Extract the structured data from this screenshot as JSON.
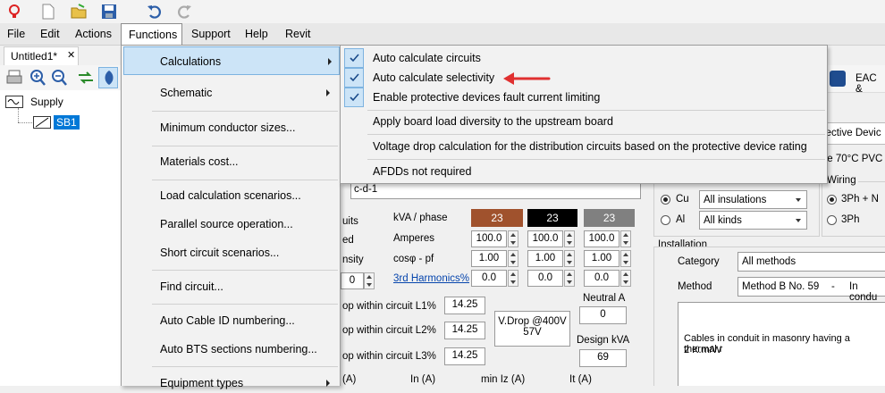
{
  "menubar": {
    "items": [
      "File",
      "Edit",
      "Actions",
      "Functions",
      "Support",
      "Help",
      "Revit"
    ]
  },
  "document_tab": {
    "label": "Untitled1*",
    "close": "✕"
  },
  "tree": {
    "root": "Supply",
    "child": "SB1"
  },
  "functions_menu": {
    "items": [
      "Calculations",
      "Schematic",
      "Minimum conductor sizes...",
      "Materials cost...",
      "Load calculation scenarios...",
      "Parallel source operation...",
      "Short circuit scenarios...",
      "Find circuit...",
      "Auto Cable ID numbering...",
      "Auto BTS sections numbering...",
      "Equipment types"
    ]
  },
  "calculations_submenu": {
    "items": [
      "Auto calculate circuits",
      "Auto calculate selectivity",
      "Enable protective devices fault current limiting",
      "Apply board load diversity to the upstream board",
      "Voltage drop calculation for the distribution circuits based on the protective device rating",
      "AFDDs not required"
    ]
  },
  "panel": {
    "ref_value": "c-d-1",
    "left_partial": [
      "uits",
      "ed",
      "nsity"
    ],
    "left_num": "0",
    "kva_label": "kVA / phase",
    "phase_kva": [
      "23",
      "23",
      "23"
    ],
    "phase_colors": [
      "#a0522d",
      "#000000",
      "#808080"
    ],
    "amperes_label": "Amperes",
    "amperes": [
      "100.0",
      "100.0",
      "100.0"
    ],
    "cosphi_label": "cosφ - pf",
    "cosphi": [
      "1.00",
      "1.00",
      "1.00"
    ],
    "harmonics_label": "3rd Harmonics%",
    "harmonics": [
      "0.0",
      "0.0",
      "0.0"
    ],
    "neutral_label": "Neutral A",
    "neutral_value": "0",
    "vdrop_l1_label": "op within circuit L1%",
    "vdrop_l1": "14.25",
    "vdrop_l2_label": "op within circuit L2%",
    "vdrop_l2": "14.25",
    "vdrop_l3_label": "op within circuit L3%",
    "vdrop_l3": "14.25",
    "vdrop_box_line1": "V.Drop @400V",
    "vdrop_box_line2": "57V",
    "design_kva_label": "Design kVA",
    "design_kva": "69",
    "bottom_labels": [
      "(A)",
      "In (A)",
      "min Iz (A)",
      "It (A)"
    ]
  },
  "right_panel": {
    "eac_label": "EAC &",
    "protective_device": "otective Devic",
    "cable_type": "ore 70°C PVC",
    "conductor_cu": "Cu",
    "conductor_al": "Al",
    "insulation": "All insulations",
    "kinds": "All kinds",
    "wiring_label": "Wiring",
    "wiring_3phn": "3Ph + N",
    "wiring_3ph": "3Ph",
    "installation_label": "Installation",
    "category_label": "Category",
    "category_value": "All methods",
    "method_label": "Method",
    "method_value": "Method B No. 59",
    "method_dash": "-",
    "method_desc": "In condu",
    "description_line1": "Cables in conduit in masonry having a thermal r",
    "description_line2": "2 K.m/W"
  }
}
